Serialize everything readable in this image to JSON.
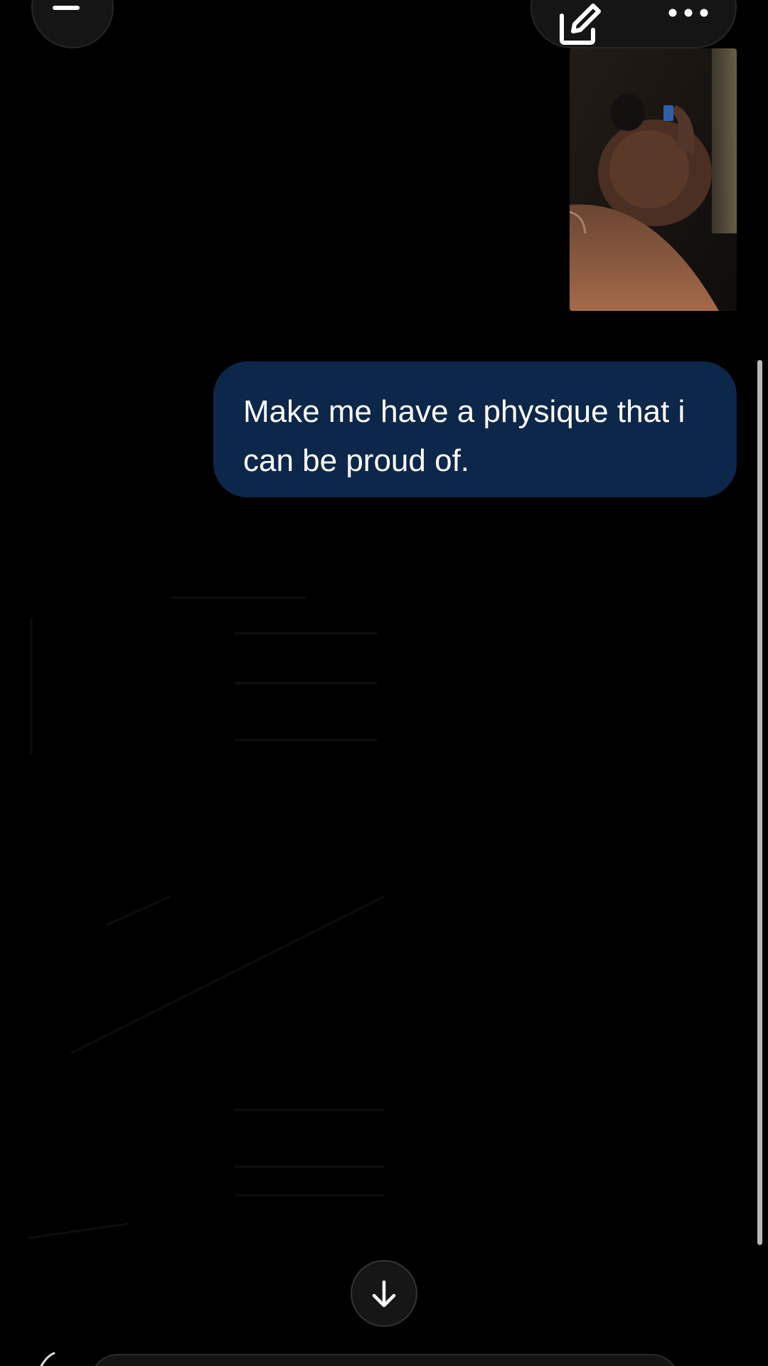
{
  "header": {
    "menu_icon": "hamburger-menu-icon",
    "new_chat_icon": "compose-edit-icon",
    "more_icon": "ellipsis-icon"
  },
  "conversation": {
    "attachment": {
      "kind": "photo",
      "description_icon": "mirror-selfie-photo"
    },
    "messages": [
      {
        "role": "user",
        "text": "Make me have a physique that i can be proud of."
      }
    ]
  },
  "controls": {
    "scroll_down_icon": "arrow-down-icon"
  },
  "colors": {
    "background": "#000000",
    "user_bubble": "#0d274a",
    "text": "#ffffff"
  }
}
